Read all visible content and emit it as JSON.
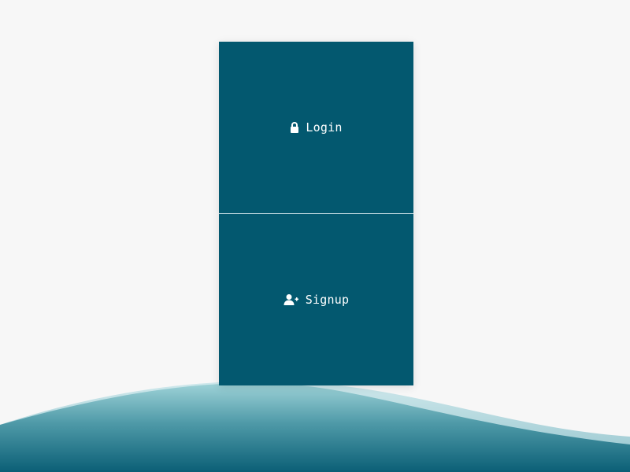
{
  "auth_panel": {
    "login": {
      "label": "Login",
      "icon": "lock-icon"
    },
    "signup": {
      "label": "Signup",
      "icon": "user-plus-icon"
    }
  },
  "colors": {
    "background": "#f7f7f7",
    "panel": "#03586f",
    "divider": "#cfe3e8",
    "text": "#ffffff",
    "wave_light": "#9ccfd6",
    "wave_dark": "#0d6379"
  }
}
